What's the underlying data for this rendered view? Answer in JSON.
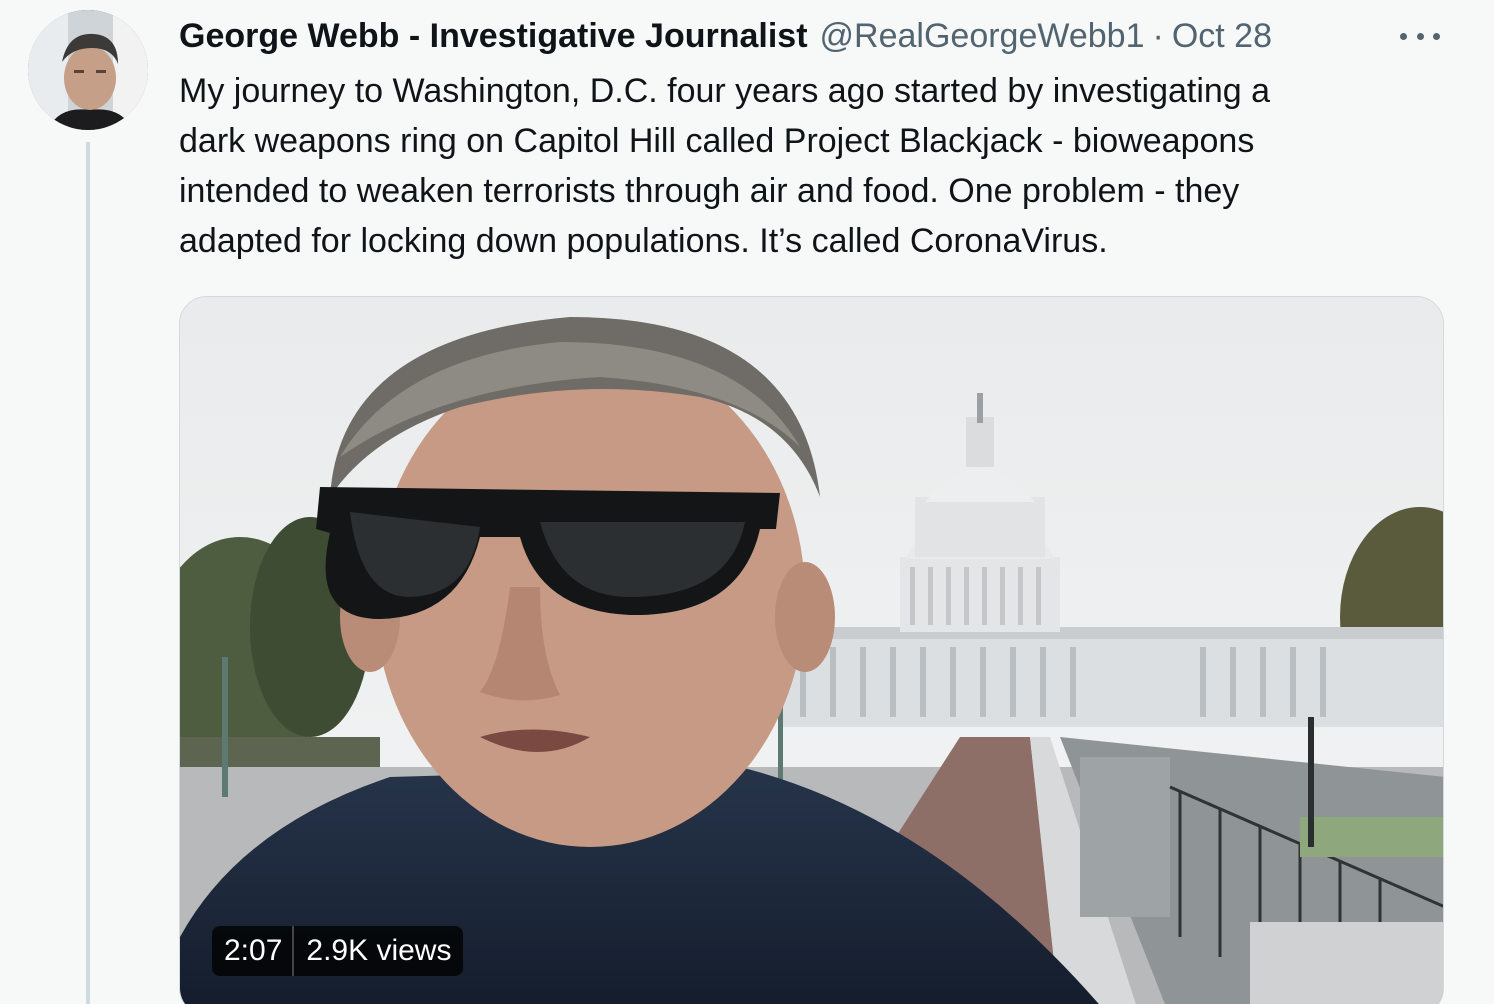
{
  "tweet": {
    "author_name": "George Webb - Investigative Journalist",
    "handle": "@RealGeorgeWebb1",
    "separator": "·",
    "date": "Oct 28",
    "text_lines": [
      "My journey to Washington, D.C. four years ago started by investigating a",
      "dark weapons ring on Capitol Hill called Project Blackjack - bioweapons",
      "intended to weaken terrorists through air and food. One problem - they",
      "adapted for locking down populations. It’s called CoronaVirus."
    ]
  },
  "video": {
    "duration": "2:07",
    "views": "2.9K views"
  },
  "colors": {
    "background": "#f7f9f9",
    "text": "#0f1419",
    "secondary": "#536471",
    "thread_line": "#cfd9de"
  },
  "icons": {
    "more": "more-horizontal-icon"
  }
}
